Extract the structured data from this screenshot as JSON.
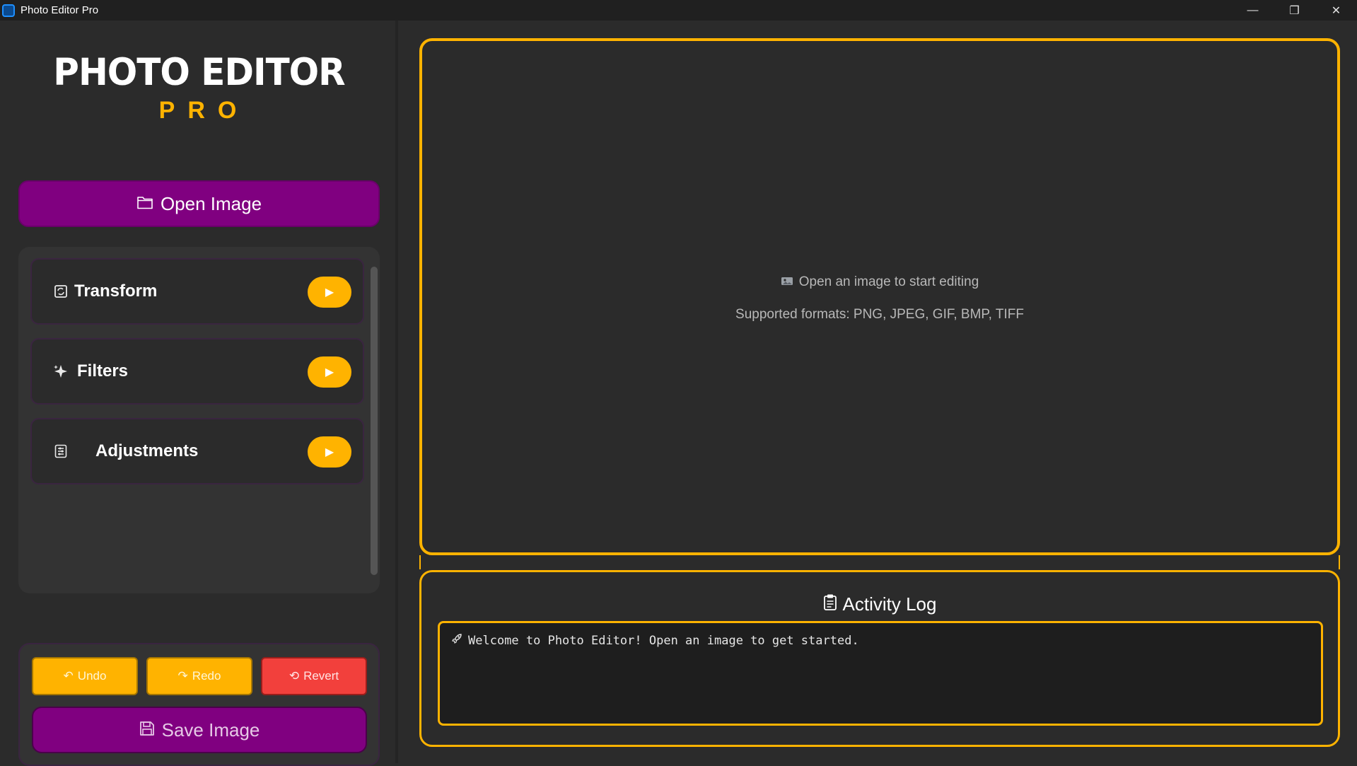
{
  "window": {
    "title": "Photo Editor Pro",
    "controls": {
      "minimize": "—",
      "maximize": "❐",
      "close": "✕"
    }
  },
  "brand": {
    "main": "PHOTO EDITOR",
    "sub": "PRO"
  },
  "sidebar": {
    "open_button": {
      "icon": "folder-icon",
      "label": "Open Image"
    },
    "tools": [
      {
        "icon": "transform-icon",
        "label": "Transform",
        "arrow": "▶"
      },
      {
        "icon": "sparkles-icon",
        "label": "Filters",
        "arrow": "▶"
      },
      {
        "icon": "sliders-icon",
        "label": "Adjustments",
        "arrow": "▶"
      }
    ],
    "actions": {
      "undo": {
        "icon": "undo-icon",
        "label": "Undo"
      },
      "redo": {
        "icon": "redo-icon",
        "label": "Redo"
      },
      "revert": {
        "icon": "revert-icon",
        "label": "Revert"
      },
      "save": {
        "icon": "floppy-icon",
        "label": "Save Image"
      }
    }
  },
  "canvas": {
    "placeholder_icon": "image-icon",
    "placeholder": "Open an image to start editing",
    "formats": "Supported formats: PNG, JPEG, GIF, BMP, TIFF"
  },
  "activity_log": {
    "icon": "clipboard-icon",
    "title": "Activity Log",
    "entries": [
      {
        "icon": "rocket-icon",
        "text": "Welcome to Photo Editor! Open an image to get started."
      }
    ]
  },
  "colors": {
    "accent": "#ffb300",
    "primary": "#800080",
    "danger": "#f2403c",
    "background": "#2b2b2b"
  }
}
